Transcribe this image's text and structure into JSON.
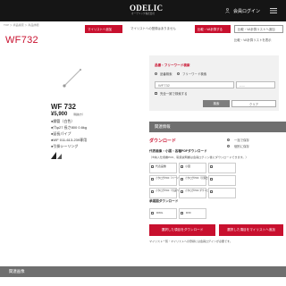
{
  "header": {
    "logo_text": "ODELIC",
    "logo_sub": "オーデリック株式会社",
    "login_label": "会員ログイン"
  },
  "breadcrumb": "TOP ＞ 商品検索 ＞ 商品詳細",
  "page_title": "WF732",
  "toolbar": {
    "mylist_button": "マイリストへ追加",
    "notice": "マイリストへの登録はありません",
    "compare_button": "比較・VA計算する",
    "clear_button": "比較・VA計算リストへ追加",
    "view_list_link": "比較・VA計算リストを表示"
  },
  "product": {
    "code": "WF 732",
    "price": "¥5,900",
    "tax": "（税抜き）",
    "specs": [
      "●鋼管（白色）",
      "●穴φ27  長さ800  0.6kg",
      "●延長パイプ",
      "●WF 011-613-239専用",
      "●引掛シーリング"
    ]
  },
  "search": {
    "title": "品番・フリーワード検索",
    "radio_product": "品番検索",
    "radio_freeword": "フリーワード検索",
    "input_value": "WF732",
    "select_value": "-----",
    "checkbox_label": "完全一致で検索する",
    "search_button": "検索",
    "clear_button": "クリア"
  },
  "related": {
    "header": "関連情報",
    "download_title": "ダウンロード",
    "option_zip": "一括で保存",
    "option_individual": "個別に保存",
    "hint": "",
    "subtitle": "代表画像・小図・各種PDFダウンロード",
    "description": "（※納入仕様書PDF、取扱説明書は会員ログイン後にダウンロードできます。）",
    "cells": [
      "代表画像",
      "小図",
      "",
      "カタログPDF（ページ指定）",
      "カタログPDF（見開き）",
      "",
      "カタログPDF（当該ページ）",
      "カタログPDF ダウンロード",
      ""
    ],
    "cad_subtitle": "承認図ダウンロード",
    "cad_opt1": "DWG",
    "cad_opt2": "DXF",
    "btn_download": "選択した項目をダウンロード",
    "btn_mylist": "選択した項目をマイリストへ追加",
    "footnote": "マイリスト一覧・マイリストへの登録には会員ログインが必要です。"
  },
  "images_header": "関連画像"
}
